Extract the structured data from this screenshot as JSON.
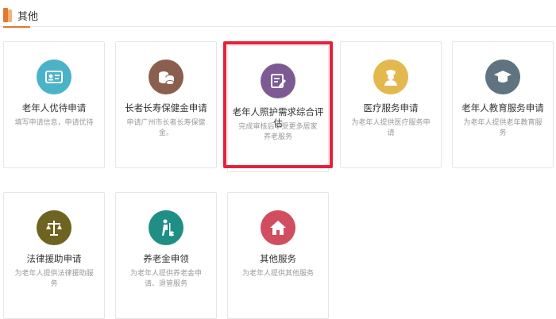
{
  "section": {
    "title": "其他"
  },
  "cards": [
    {
      "title": "老年人优待申请",
      "desc": "填写申请信息，申请优待",
      "color": "#4bb3c8",
      "icon": "id-card-icon"
    },
    {
      "title": "长者长寿保健金申请",
      "desc": "申请广州市长者长寿保健金。",
      "color": "#8b5f4e",
      "icon": "coins-icon"
    },
    {
      "title": "老年人照护需求综合评估",
      "desc": "完成审核后享受更多居家养老服务",
      "color": "#7e5a94",
      "icon": "edit-document-icon"
    },
    {
      "title": "医疗服务申请",
      "desc": "为老年人提供医疗服务申请",
      "color": "#e3b84e",
      "icon": "nurse-icon"
    },
    {
      "title": "老年人教育服务申请",
      "desc": "为老年人提供老年教育服务",
      "color": "#5f7480",
      "icon": "graduation-cap-icon"
    },
    {
      "title": "法律援助申请",
      "desc": "为老年人提供法律援助服务",
      "color": "#6f6321",
      "icon": "scales-icon"
    },
    {
      "title": "养老金申领",
      "desc": "为老年人提供养老金申请、退管服务",
      "color": "#1f8f86",
      "icon": "pension-icon"
    },
    {
      "title": "其他服务",
      "desc": "为老年人提供其他服务",
      "color": "#d04e5f",
      "icon": "home-icon"
    }
  ]
}
